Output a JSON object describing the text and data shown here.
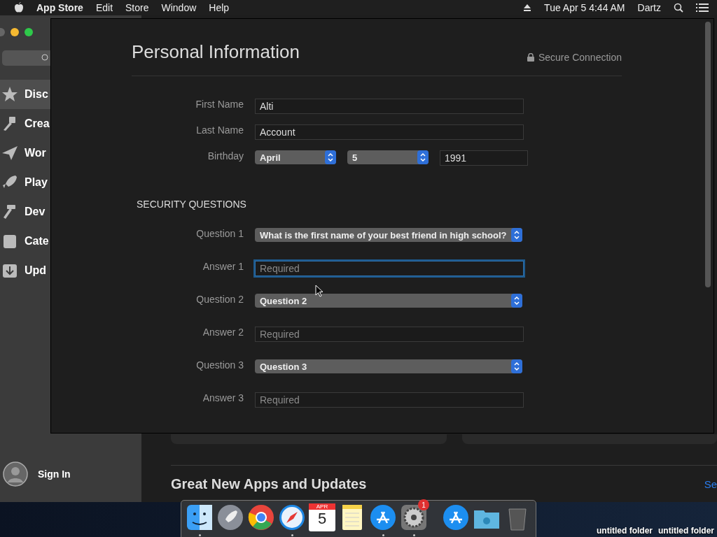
{
  "menu_bar": {
    "app": "App Store",
    "menus": [
      "Edit",
      "Store",
      "Window",
      "Help"
    ],
    "clock": "Tue Apr 5  4:44 AM",
    "user": "Dartz"
  },
  "sidebar": {
    "items": [
      {
        "label": "Disc",
        "selected": true
      },
      {
        "label": "Crea",
        "selected": false
      },
      {
        "label": "Wor",
        "selected": false
      },
      {
        "label": "Play",
        "selected": false
      },
      {
        "label": "Dev",
        "selected": false
      },
      {
        "label": "Cate",
        "selected": false
      },
      {
        "label": "Upd",
        "selected": false
      }
    ],
    "sign_in": "Sign In"
  },
  "content": {
    "section_title": "Great New Apps and Updates",
    "see_link": "Se"
  },
  "sheet": {
    "title": "Personal Information",
    "secure": "Secure Connection",
    "rows": [
      {
        "kind": "text",
        "label": "First Name",
        "value": "Alti",
        "focused": false
      },
      {
        "kind": "text",
        "label": "Last Name",
        "value": "Account",
        "focused": false
      },
      {
        "kind": "date",
        "label": "Birthday",
        "month": "April",
        "day": "5",
        "year": "1991"
      }
    ],
    "security": {
      "heading": "SECURITY QUESTIONS",
      "rows": [
        {
          "kind": "select",
          "label": "Question 1",
          "value": "What is the first name of your best friend in high school?"
        },
        {
          "kind": "text",
          "label": "Answer 1",
          "placeholder": "Required",
          "focused": true
        },
        {
          "kind": "select",
          "label": "Question 2",
          "value": "Question 2"
        },
        {
          "kind": "text",
          "label": "Answer 2",
          "placeholder": "Required",
          "focused": false
        },
        {
          "kind": "select",
          "label": "Question 3",
          "value": "Question 3"
        },
        {
          "kind": "text",
          "label": "Answer 3",
          "placeholder": "Required",
          "focused": false
        }
      ]
    }
  },
  "desktop": {
    "labels": [
      "untitled folder",
      "untitled folder"
    ]
  },
  "dock": [
    {
      "kind": "finder",
      "running": true
    },
    {
      "kind": "launchpad",
      "running": false
    },
    {
      "kind": "chrome",
      "running": false
    },
    {
      "kind": "safari",
      "running": true
    },
    {
      "kind": "calendar",
      "running": false,
      "month": "APR",
      "day": "5"
    },
    {
      "kind": "notes",
      "running": false
    },
    {
      "kind": "appstore",
      "running": true
    },
    {
      "kind": "settings",
      "running": true,
      "badge": "1"
    },
    {
      "kind": "separator"
    },
    {
      "kind": "appstore",
      "running": false
    },
    {
      "kind": "folder",
      "running": false
    },
    {
      "kind": "trash",
      "running": false
    }
  ]
}
